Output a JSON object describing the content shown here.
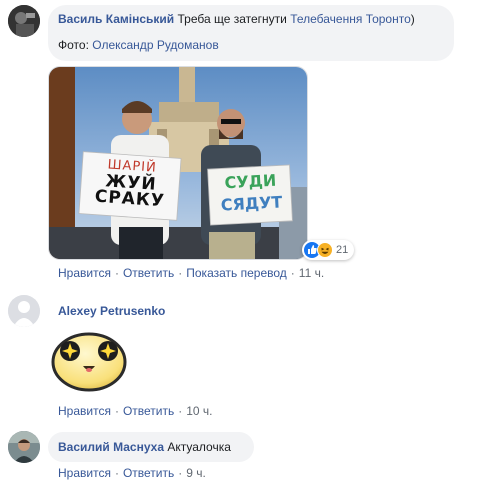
{
  "comments": [
    {
      "author": "Василь Камінський",
      "text": "Треба ще затегнути",
      "mention": "Телебачення Торонто",
      "text_after": ")",
      "caption_prefix": "Фото:",
      "caption_author": "Олександр Рудоманов",
      "photo": {
        "sign_left": [
          "ШАРІЙ",
          "ЖУЙ",
          "СРАКУ"
        ],
        "sign_right": [
          "СУДИ",
          "СЯДУТ"
        ]
      },
      "reactions": {
        "icons": [
          "like-icon",
          "haha-icon"
        ],
        "count": "21"
      },
      "actions": {
        "like": "Нравится",
        "reply": "Ответить",
        "translate": "Показать перевод",
        "time": "11 ч."
      }
    },
    {
      "author": "Alexey Petrusenko",
      "sticker": "starry-eyed-face-sticker",
      "actions": {
        "like": "Нравится",
        "reply": "Ответить",
        "time": "10 ч."
      }
    },
    {
      "author": "Василий Маснуха",
      "text": "Актуалочка",
      "actions": {
        "like": "Нравится",
        "reply": "Ответить",
        "time": "9 ч."
      }
    }
  ],
  "colors": {
    "link": "#385898",
    "bubble": "#f2f3f5",
    "muted": "#606770",
    "like_blue": "#1877f2",
    "haha_yellow": "#f7b125"
  },
  "separator": "·"
}
